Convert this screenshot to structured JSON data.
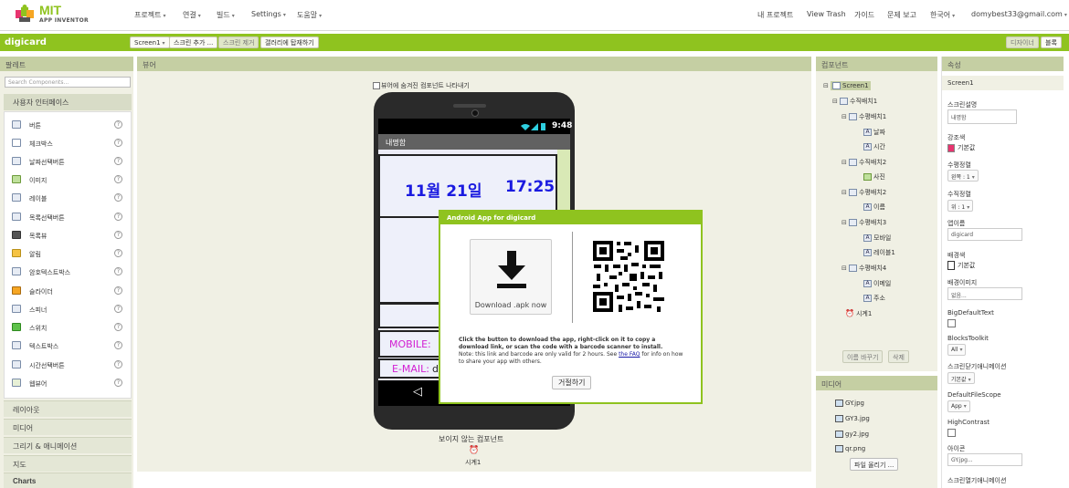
{
  "colors": {
    "accent": "#8fc31f",
    "panel_title": "#c5cfa3",
    "date_time": "#1a1ae0",
    "label_magenta": "#d21fd2",
    "accent_swatch": "#e8346f"
  },
  "nav": {
    "logo_title": "MIT",
    "logo_sub": "APP INVENTOR",
    "left_menus": [
      "프로젝트",
      "연결",
      "빌드",
      "Settings",
      "도움말"
    ],
    "right_links": [
      "내 프로젝트",
      "View Trash",
      "가이드",
      "문제 보고",
      "한국어",
      "domybest33@gmail.com"
    ]
  },
  "projbar": {
    "project_name": "digicard",
    "screen_select": "Screen1",
    "add_screen": "스크린 추가 ...",
    "remove_screen": "스크린 제거",
    "gallery_publish": "갤러리에 탑재하기",
    "designer": "디자이너",
    "blocks": "블록"
  },
  "palette": {
    "title": "팔레트",
    "search_placeholder": "Search Components...",
    "ui_header": "사용자 인터페이스",
    "items": [
      "버튼",
      "체크박스",
      "날짜선택버튼",
      "이미지",
      "레이블",
      "목록선택버튼",
      "목록뷰",
      "알림",
      "암호텍스트박스",
      "슬라이더",
      "스피너",
      "스위치",
      "텍스트박스",
      "시간선택버튼",
      "웹뷰어"
    ],
    "categories": [
      "레이아웃",
      "미디어",
      "그리기 & 애니메이션",
      "지도",
      "Charts"
    ]
  },
  "viewer": {
    "title": "뷰어",
    "show_hidden": "뷰어에 숨겨진 컴포넌트 나타내기",
    "status_time": "9:48",
    "app_title": "내명함",
    "date": "11월 21일",
    "time": "17:25",
    "mobile_label": "MOBILE:",
    "email_label": "E-MAIL:",
    "email_value_partial": "d",
    "invisible_label": "보이지 않는 컴포넌트",
    "invisible_item": "시계1"
  },
  "dialog": {
    "title": "Android App for digicard",
    "download_label": "Download .apk now",
    "text_bold": "Click the button to download the app, right-click on it to copy a download link, or scan the code with a barcode scanner to install.",
    "text_note": "Note: this link and barcode are only valid for 2 hours. See ",
    "link": "the FAQ",
    "text_after": " for info on how to share your app with others.",
    "close": "거절하기"
  },
  "components": {
    "title": "컴포넌트",
    "tree": [
      {
        "label": "Screen1",
        "depth": 0
      },
      {
        "label": "수직배치1",
        "depth": 1
      },
      {
        "label": "수평배치1",
        "depth": 2
      },
      {
        "label": "날짜",
        "depth": 3
      },
      {
        "label": "시간",
        "depth": 3
      },
      {
        "label": "수직배치2",
        "depth": 2
      },
      {
        "label": "사진",
        "depth": 3
      },
      {
        "label": "수평배치2",
        "depth": 2
      },
      {
        "label": "이름",
        "depth": 3
      },
      {
        "label": "수평배치3",
        "depth": 2
      },
      {
        "label": "모바일",
        "depth": 3
      },
      {
        "label": "레이블1",
        "depth": 3
      },
      {
        "label": "수평배치4",
        "depth": 2
      },
      {
        "label": "이메일",
        "depth": 3
      },
      {
        "label": "주소",
        "depth": 3
      },
      {
        "label": "시계1",
        "depth": 2
      }
    ],
    "rename": "이름 바꾸기",
    "delete": "삭제"
  },
  "media": {
    "title": "미디어",
    "files": [
      "GY.jpg",
      "GY3.jpg",
      "gy2.jpg",
      "qr.png"
    ],
    "upload": "파일 올리기 ..."
  },
  "properties": {
    "title": "속성",
    "component": "Screen1",
    "about_label": "스크린설명",
    "about_value": "내명함",
    "accent_label": "강조색",
    "accent_value": "기본값",
    "align_h_label": "수평정렬",
    "align_h_value": "왼쪽 : 1",
    "align_v_label": "수직정렬",
    "align_v_value": "위 : 1",
    "app_name_label": "앱이름",
    "app_name_value": "digicard",
    "bg_color_label": "배경색",
    "bg_color_value": "기본값",
    "bg_image_label": "배경이미지",
    "bg_image_value": "없음...",
    "big_default_text": "BigDefaultText",
    "blocks_toolkit": "BlocksToolkit",
    "blocks_toolkit_value": "All",
    "close_anim_label": "스크린닫기애니메이션",
    "close_anim_value": "기본값",
    "default_scope": "DefaultFileScope",
    "default_scope_value": "App",
    "high_contrast": "HighContrast",
    "icon_label": "아이콘",
    "icon_value": "GY.jpg...",
    "open_anim_label": "스크린열기애니메이션"
  }
}
